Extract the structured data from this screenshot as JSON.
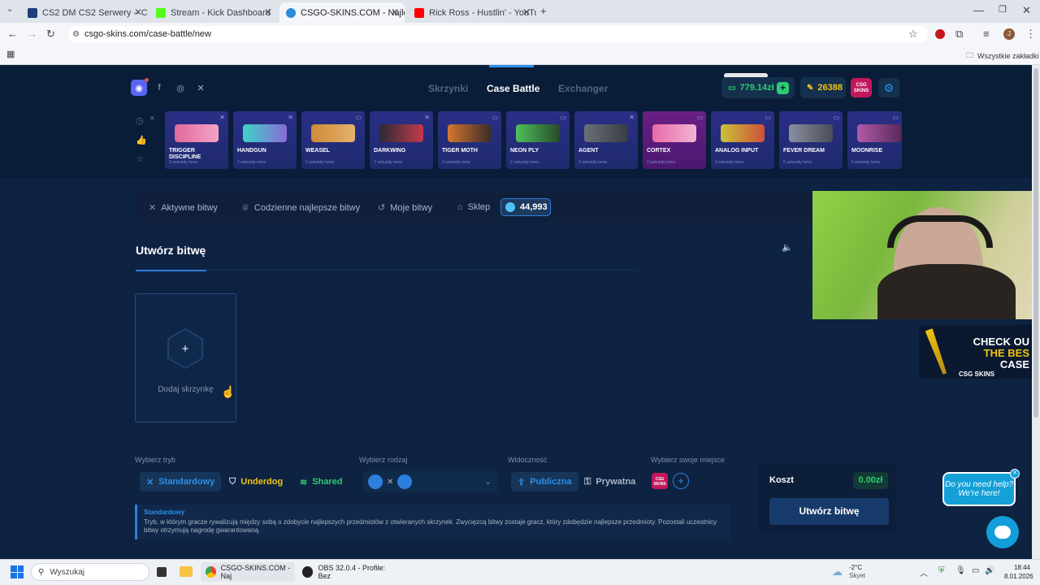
{
  "browser": {
    "tabs": [
      {
        "title": "CS2 DM CS2 Serwery – CYBERS",
        "color": "#1c3f7a"
      },
      {
        "title": "Stream - Kick Dashboard",
        "color": "#53fc18"
      },
      {
        "title": "CSGO-SKINS.COM - Najlepsze",
        "color": "#2b8cd6"
      },
      {
        "title": "Rick Ross - Hustlin' - YouTu",
        "color": "#ff0000"
      }
    ],
    "url": "csgo-skins.com/case-battle/new",
    "bookmarks_label": "Wszystkie zakładki",
    "profile_initial": "J"
  },
  "header": {
    "nav": [
      "Skrzynki",
      "Case Battle",
      "Exchanger"
    ],
    "active_nav": 1,
    "balance": "779.14zł",
    "coins": "26388",
    "logo_text": "CSG SKINS"
  },
  "live_drops": [
    {
      "name": "TRIGGER DISCIPLINE",
      "time": "2 sekundy temu",
      "gun": "#e16a9a"
    },
    {
      "name": "HANDGUN",
      "time": "2 sekundy temu",
      "gun": "#3fd3c9"
    },
    {
      "name": "WEASEL",
      "time": "2 sekundy temu",
      "gun": "#d08a3a"
    },
    {
      "name": "DARKWING",
      "time": "2 sekundy temu",
      "gun": "#c43b4a"
    },
    {
      "name": "TIGER MOTH",
      "time": "2 sekundy temu",
      "gun": "#d3772f"
    },
    {
      "name": "NEON PLY",
      "time": "2 sekundy temu",
      "gun": "#4cc05a"
    },
    {
      "name": "AGENT",
      "time": "2 sekundy temu",
      "gun": "#6a7078"
    },
    {
      "name": "CORTEX",
      "time": "2 sekundy temu",
      "gun": "#e86aa8"
    },
    {
      "name": "ANALOG INPUT",
      "time": "3 sekundy temu",
      "gun": "#c9c23a"
    },
    {
      "name": "FEVER DREAM",
      "time": "5 sekundy temu",
      "gun": "#8a8fa0"
    },
    {
      "name": "MOONRISE",
      "time": "5 sekundy temu",
      "gun": "#b25aa8"
    }
  ],
  "battle_nav": {
    "items": [
      "Aktywne bitwy",
      "Codzienne najlepsze bitwy",
      "Moje bitwy",
      "Sklep"
    ],
    "gems": "44,993"
  },
  "create": {
    "title": "Utwórz bitwę",
    "add_case": "Dodaj skrzynkę",
    "mode_label": "Wybierz tryb",
    "modes": [
      "Standardowy",
      "Underdog",
      "Shared"
    ],
    "type_label": "Wybierz rodzaj",
    "visibility_label": "Widoczność",
    "visibility": [
      "Publiczna",
      "Prywatna"
    ],
    "seat_label": "Wybierz swoje miejsce",
    "desc_title": "Standardowy",
    "desc_body": "Tryb, w którym gracze rywalizują między sobą o zdobycie najlepszych przedmiotów z otwieranych skrzynek. Zwycięzcą bitwy zostaje gracz, który zdobędzie najlepsze przedmioty. Pozostali uczestnicy bitwy otrzymują nagrodę gwarantowaną.",
    "cost_label": "Koszt",
    "cost_value": "0.00zł",
    "submit": "Utwórz bitwę"
  },
  "ad": {
    "line1": "CHECK OU",
    "line2": "THE BES",
    "line3": "CASE",
    "brand": "CSG SKINS"
  },
  "chat": {
    "bubble": "Do you need help? We're here!"
  },
  "taskbar": {
    "search": "Wyszukaj",
    "apps": [
      "CSGO-SKINS.COM - Naj",
      "OBS 32.0.4 - Profile: Bez"
    ],
    "weather_temp": "-2°C",
    "weather_desc": "Skyet",
    "time": "18:44",
    "date": "8.01.2026"
  },
  "colors": {
    "accent": "#2d7fdc",
    "green": "#2ecc71",
    "gold": "#f1c40f"
  }
}
